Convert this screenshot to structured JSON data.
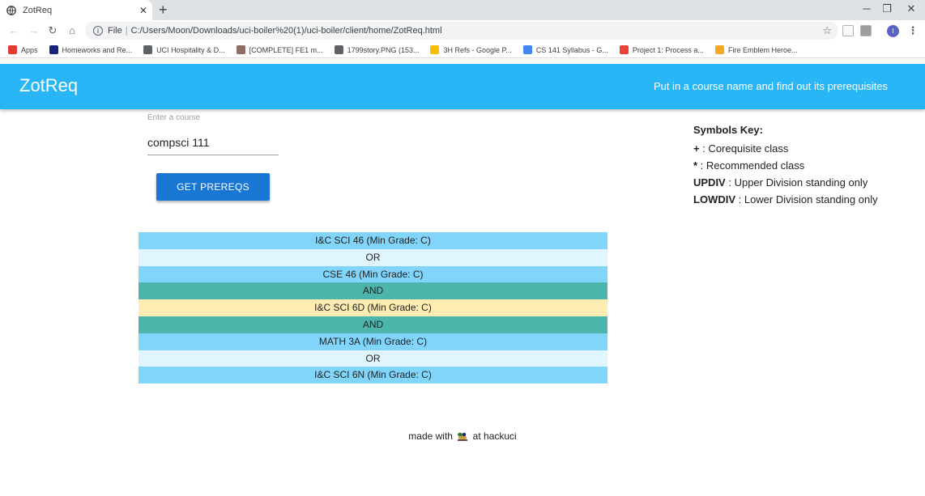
{
  "browser": {
    "tab_title": "ZotReq",
    "url_protocol": "File",
    "url_path": "C:/Users/Moon/Downloads/uci-boiler%20(1)/uci-boiler/client/home/ZotReq.html",
    "profile_initial": "I",
    "bookmarks": [
      {
        "label": "Apps",
        "icon": "apps-grid-icon",
        "color": "#e53935"
      },
      {
        "label": "Homeworks and Re...",
        "icon": "uci-icon",
        "color": "#1a237e"
      },
      {
        "label": "UCI Hospitality & D...",
        "icon": "globe-icon",
        "color": "#5f6368"
      },
      {
        "label": "[COMPLETE] FE1 m...",
        "icon": "seal-icon",
        "color": "#8d6e63"
      },
      {
        "label": "1799story.PNG (153...",
        "icon": "globe-icon",
        "color": "#5f6368"
      },
      {
        "label": "3H Refs - Google P...",
        "icon": "pinwheel-icon",
        "color": "#fbbc04"
      },
      {
        "label": "CS 141 Syllabus - G...",
        "icon": "docs-icon",
        "color": "#4285f4"
      },
      {
        "label": "Project 1: Process a...",
        "icon": "diamond-icon",
        "color": "#ea4335"
      },
      {
        "label": "Fire Emblem Heroe...",
        "icon": "emblem-icon",
        "color": "#f9a825"
      }
    ]
  },
  "header": {
    "title": "ZotReq",
    "tagline": "Put in a course name and find out its prerequisites",
    "bg_color": "#29b6f6"
  },
  "search": {
    "label": "Enter a course",
    "value": "compsci 111",
    "button_label": "GET PREREQS"
  },
  "symbols_key": {
    "title": "Symbols Key:",
    "items": [
      {
        "symbol": "+",
        "desc": " : Corequisite class"
      },
      {
        "symbol": "*",
        "desc": " : Recommended class"
      },
      {
        "symbol": "UPDIV",
        "desc": " : Upper Division standing only"
      },
      {
        "symbol": "LOWDIV",
        "desc": " : Lower Division standing only"
      }
    ]
  },
  "results": [
    {
      "text": "I&C SCI 46 (Min Grade: C)",
      "kind": "course"
    },
    {
      "text": "OR",
      "kind": "or"
    },
    {
      "text": "CSE 46 (Min Grade: C)",
      "kind": "course"
    },
    {
      "text": "AND",
      "kind": "and"
    },
    {
      "text": "I&C SCI 6D (Min Grade: C)",
      "kind": "highlight"
    },
    {
      "text": "AND",
      "kind": "and"
    },
    {
      "text": "MATH 3A (Min Grade: C)",
      "kind": "course"
    },
    {
      "text": "OR",
      "kind": "or"
    },
    {
      "text": "I&C SCI 6N (Min Grade: C)",
      "kind": "course"
    }
  ],
  "footer": {
    "before": "made with",
    "icon": "anteater-icon",
    "after": "at hackuci"
  }
}
